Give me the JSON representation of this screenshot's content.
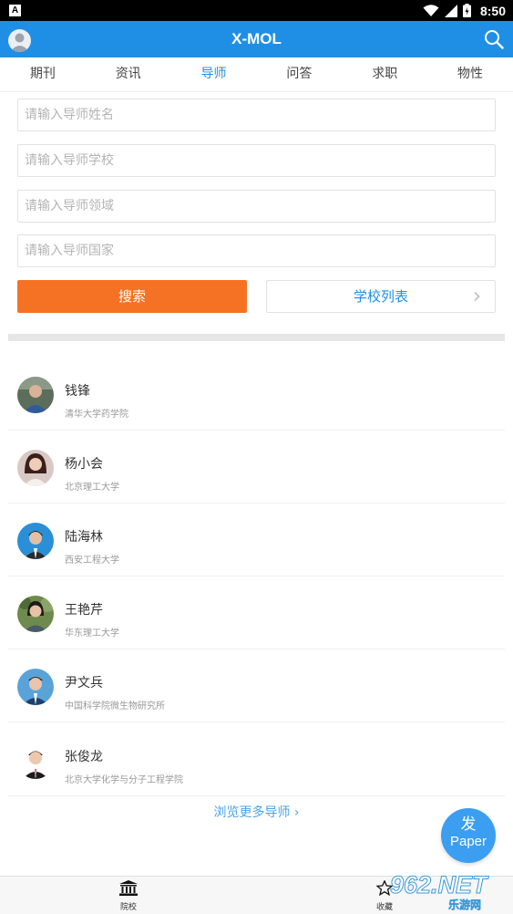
{
  "status_bar": {
    "time": "8:50"
  },
  "app": {
    "title": "X-MOL"
  },
  "tabs": [
    {
      "label": "期刊"
    },
    {
      "label": "资讯"
    },
    {
      "label": "导师"
    },
    {
      "label": "问答"
    },
    {
      "label": "求职"
    },
    {
      "label": "物性"
    }
  ],
  "active_tab": "导师",
  "form": {
    "name_placeholder": "请输入导师姓名",
    "school_placeholder": "请输入导师学校",
    "field_placeholder": "请输入导师领域",
    "country_placeholder": "请输入导师国家",
    "search_label": "搜索",
    "school_list_label": "学校列表"
  },
  "tutors": [
    {
      "name": "钱锋",
      "school": "清华大学药学院"
    },
    {
      "name": "杨小会",
      "school": "北京理工大学"
    },
    {
      "name": "陆海林",
      "school": "西安工程大学"
    },
    {
      "name": "王艳芹",
      "school": "华东理工大学"
    },
    {
      "name": "尹文兵",
      "school": "中国科学院微生物研究所"
    },
    {
      "name": "张俊龙",
      "school": "北京大学化学与分子工程学院"
    }
  ],
  "browse_more": "浏览更多导师 ›",
  "fab": {
    "line1": "发",
    "line2": "Paper"
  },
  "bottom_nav": [
    {
      "label": "院校",
      "icon": "institution-icon"
    },
    {
      "label": "收藏",
      "icon": "star-icon"
    }
  ],
  "watermark": {
    "text": "962.NET",
    "subtext": "乐游网"
  },
  "colors": {
    "brand_blue": "#1f8fe6",
    "search_orange": "#f57224"
  }
}
